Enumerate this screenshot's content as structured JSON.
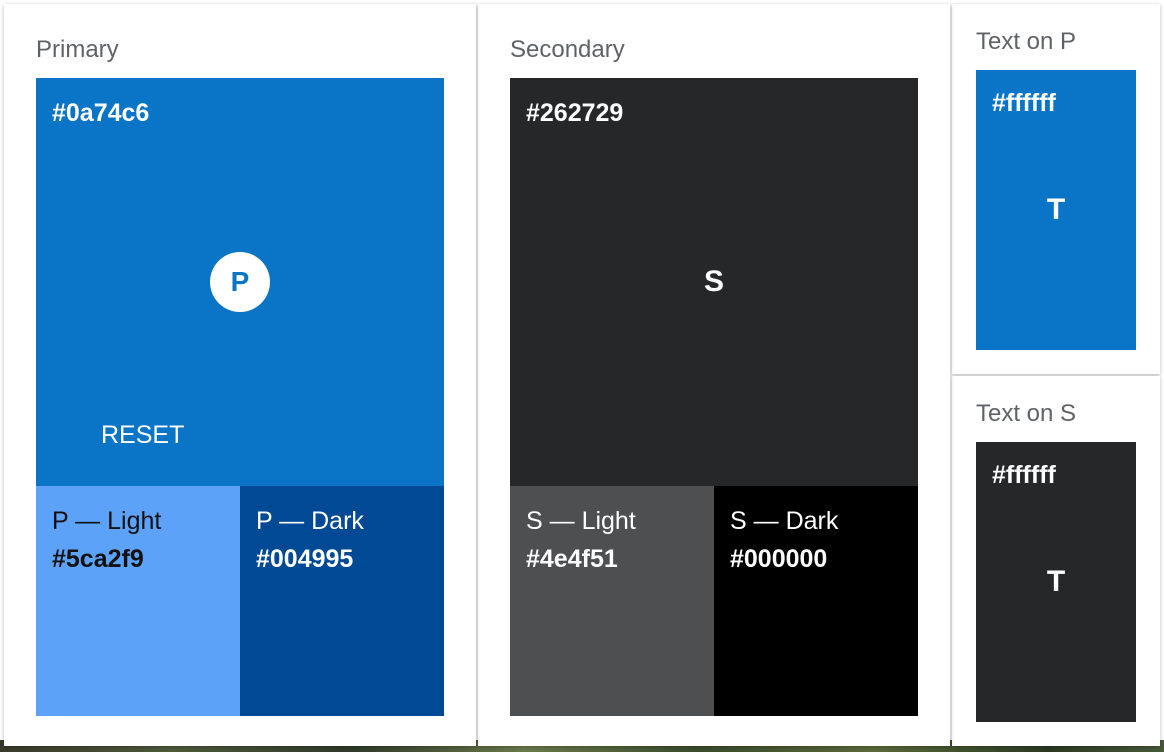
{
  "colors": {
    "primary": "#0a74c6",
    "primary_light": "#5ca2f9",
    "primary_dark": "#004995",
    "secondary": "#262729",
    "secondary_light": "#4e4f51",
    "secondary_dark": "#000000",
    "text_on_primary": "#ffffff",
    "text_on_secondary": "#ffffff"
  },
  "primary": {
    "label": "Primary",
    "hex": "#0a74c6",
    "letter": "P",
    "reset_label": "RESET",
    "light": {
      "name": "P — Light",
      "hex": "#5ca2f9"
    },
    "dark": {
      "name": "P — Dark",
      "hex": "#004995"
    }
  },
  "secondary": {
    "label": "Secondary",
    "hex": "#262729",
    "letter": "S",
    "light": {
      "name": "S — Light",
      "hex": "#4e4f51"
    },
    "dark": {
      "name": "S — Dark",
      "hex": "#000000"
    }
  },
  "text_on_p": {
    "label": "Text on P",
    "hex": "#ffffff",
    "letter": "T"
  },
  "text_on_s": {
    "label": "Text on S",
    "hex": "#ffffff",
    "letter": "T"
  }
}
